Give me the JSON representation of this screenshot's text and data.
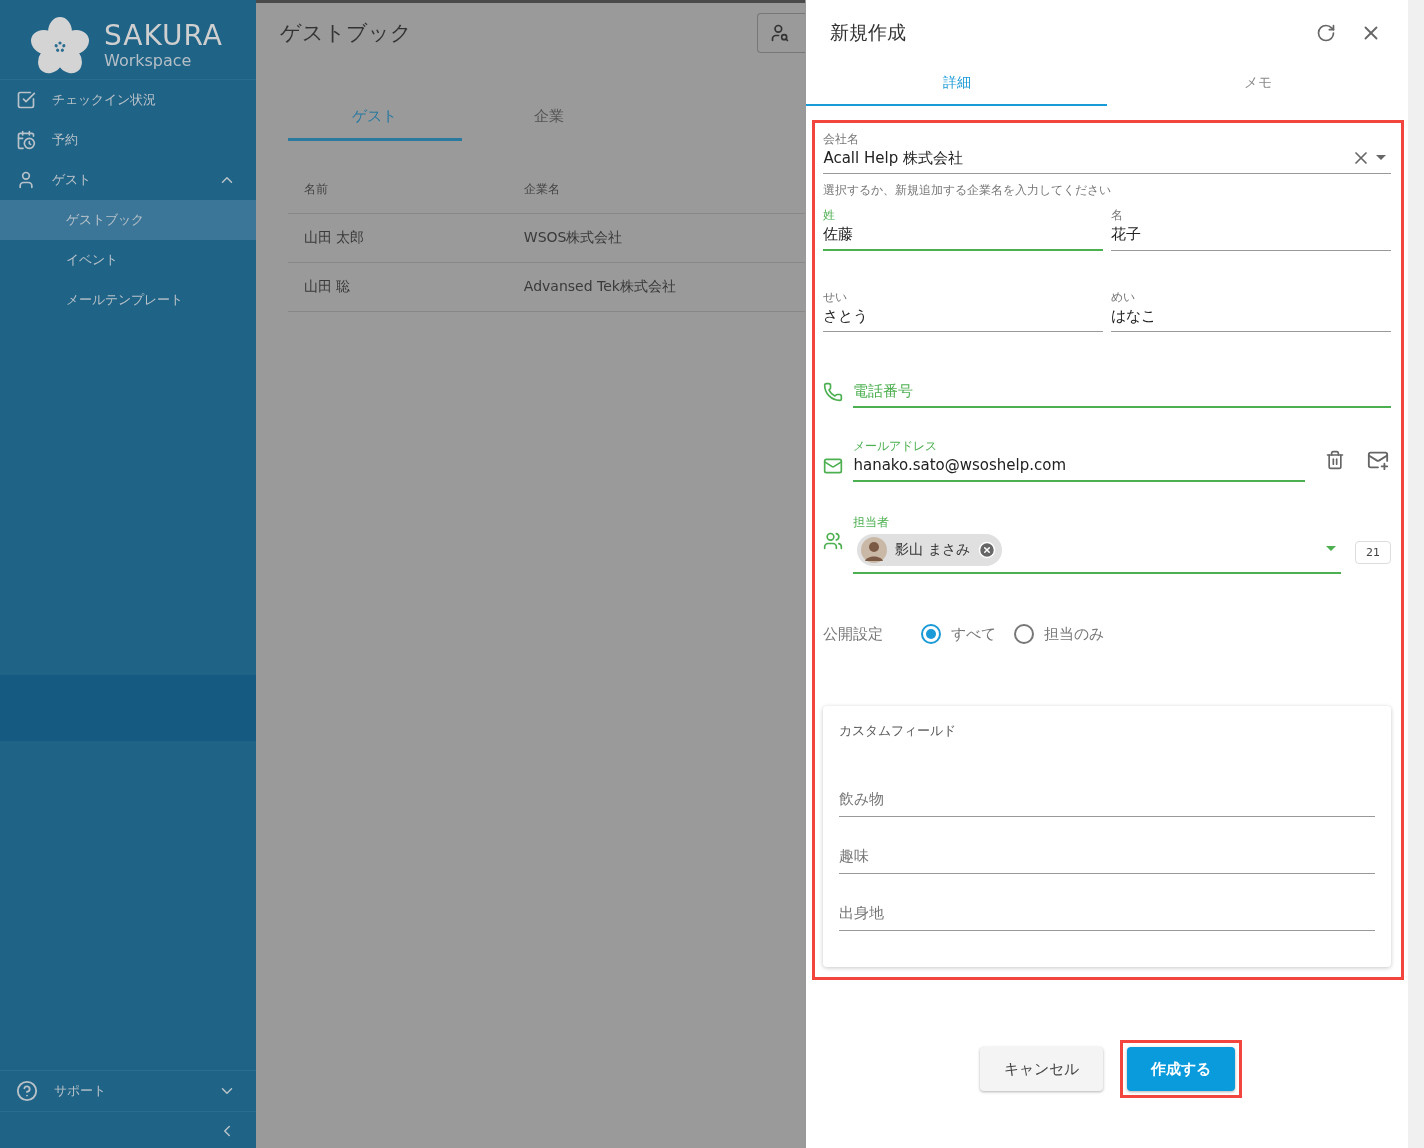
{
  "sidebar": {
    "brand": {
      "name": "SAKURA",
      "subtitle": "Workspace"
    },
    "items": [
      {
        "label": "チェックイン状況",
        "kind": "check"
      },
      {
        "label": "予約",
        "kind": "calendar"
      },
      {
        "label": "ゲスト",
        "kind": "guest",
        "expanded": true,
        "children": [
          {
            "label": "ゲストブック",
            "selected": true
          },
          {
            "label": "イベント",
            "selected": false
          },
          {
            "label": "メールテンプレート",
            "selected": false
          }
        ]
      }
    ],
    "footer": {
      "label": "サポート",
      "expanded": false
    }
  },
  "main": {
    "title": "ゲストブック",
    "tabs": [
      {
        "label": "ゲスト",
        "selected": true
      },
      {
        "label": "企業",
        "selected": false
      }
    ],
    "table": {
      "columns": [
        "名前",
        "企業名"
      ],
      "rows": [
        [
          "山田 太郎",
          "WSOS株式会社"
        ],
        [
          "山田 聡",
          "Advansed Tek株式会社"
        ]
      ]
    }
  },
  "drawer": {
    "title": "新規作成",
    "tabs": [
      {
        "label": "詳細",
        "selected": true
      },
      {
        "label": "メモ",
        "selected": false
      }
    ],
    "form": {
      "highlighted": true,
      "company": {
        "label": "会社名",
        "value": "Acall Help 株式会社",
        "hint": "選択するか、新規追加する企業名を入力してください"
      },
      "name_rows": [
        [
          {
            "label": "姓",
            "value": "佐藤",
            "focused": true
          },
          {
            "label": "名",
            "value": "花子",
            "focused": false
          }
        ],
        [
          {
            "label": "せい",
            "value": "さとう",
            "focused": false
          },
          {
            "label": "めい",
            "value": "はなこ",
            "focused": false
          }
        ]
      ],
      "phone": {
        "placeholder": "電話番号"
      },
      "email": {
        "label": "メールアドレス",
        "value": "hanako.sato@wsoshelp.com"
      },
      "assignee": {
        "label": "担当者",
        "chips": [
          "影山 まさみ"
        ],
        "count": "21"
      },
      "visibility": {
        "label": "公開設定",
        "options": [
          {
            "label": "すべて",
            "selected": true
          },
          {
            "label": "担当のみ",
            "selected": false
          }
        ]
      },
      "custom_fields": {
        "title": "カスタムフィールド",
        "fields": [
          {
            "placeholder": "飲み物"
          },
          {
            "placeholder": "趣味"
          },
          {
            "placeholder": "出身地"
          }
        ]
      }
    },
    "buttons": [
      {
        "label": "キャンセル",
        "kind": "secondary",
        "highlighted": false
      },
      {
        "label": "作成する",
        "kind": "primary",
        "highlighted": true
      }
    ]
  }
}
